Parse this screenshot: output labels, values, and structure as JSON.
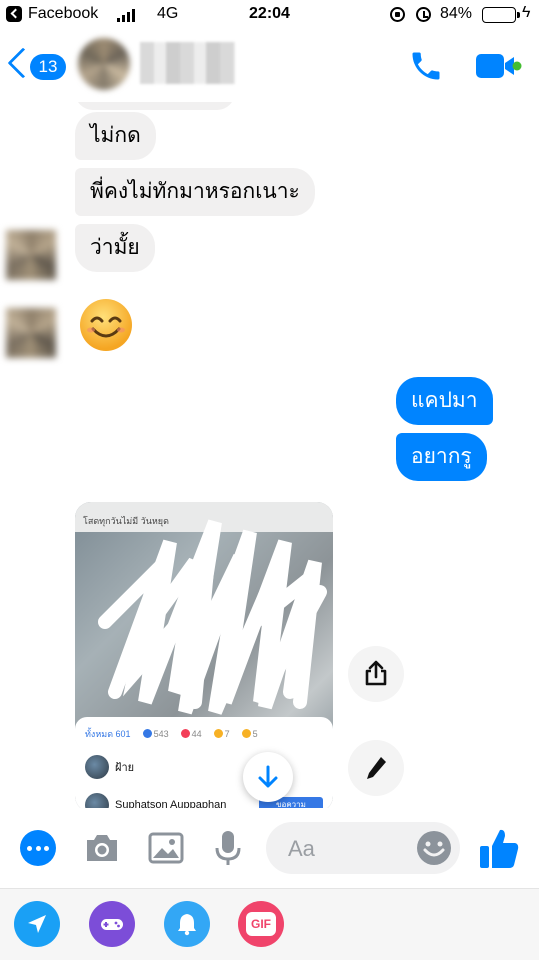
{
  "status_bar": {
    "back_app": "Facebook",
    "network": "4G",
    "time": "22:04",
    "battery_percent": "84%",
    "battery_level": 0.84
  },
  "header": {
    "unread_count": "13",
    "contact_name": "",
    "accent_color": "#0084ff"
  },
  "messages": {
    "incoming": [
      "ไม่กด",
      "พี่คงไม่ทักมาหรอกเนาะ",
      "ว่ามั้ย"
    ],
    "incoming_emoji": "smiling-face",
    "outgoing": [
      "แคปมา",
      "อยากรู"
    ]
  },
  "shared_image": {
    "top_caption": "โสดทุกวันไม่มี  วันหยุด",
    "tabs": {
      "all": "ทั้งหมด 601",
      "like": "543",
      "love": "44",
      "wow": "7",
      "haha": "5"
    },
    "row1_name": "ฝ้าย",
    "row2_name": "Suphatson Auppaphan",
    "add_button": "ขอความ"
  },
  "composer": {
    "placeholder": "Aa"
  },
  "icons": [
    "call-icon",
    "video-call-icon",
    "share-icon",
    "edit-icon",
    "scroll-down-icon",
    "more-icon",
    "camera-icon",
    "gallery-icon",
    "microphone-icon",
    "emoji-icon",
    "like-icon",
    "location-icon",
    "games-icon",
    "reminder-icon",
    "gif-icon"
  ]
}
